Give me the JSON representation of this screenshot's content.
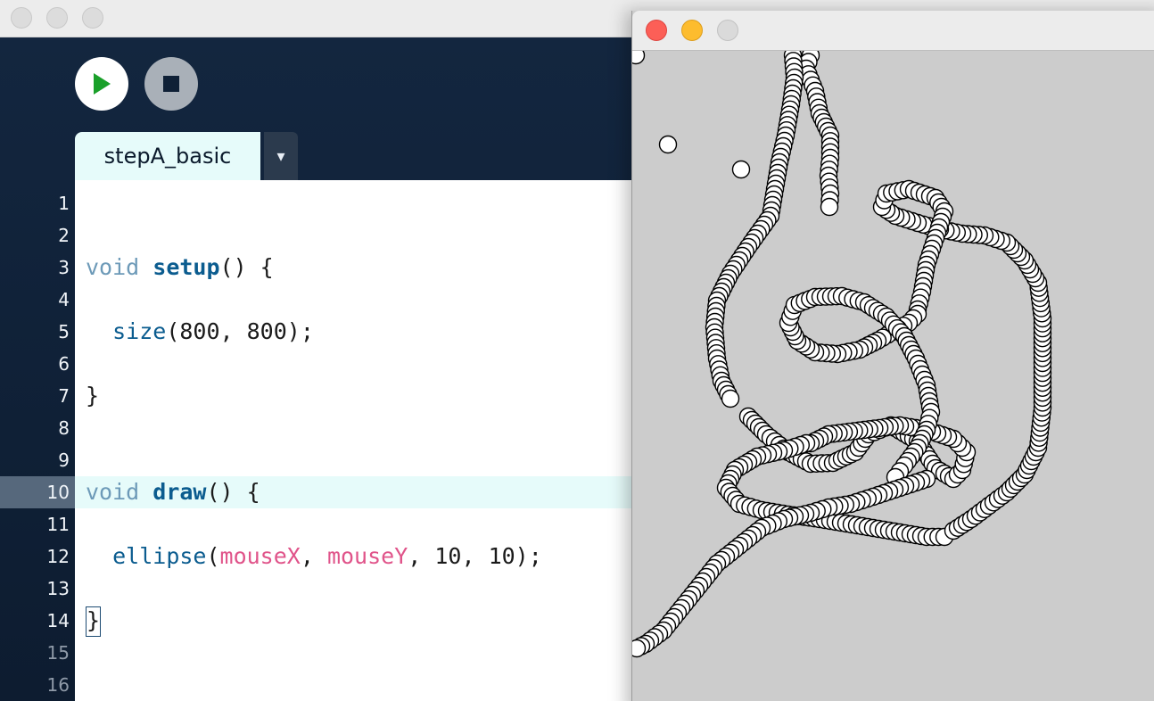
{
  "editor": {
    "tab_label": "stepA_basic",
    "tab_menu_icon": "▾",
    "active_line": 10,
    "lines": [
      {
        "num": "1",
        "segments": []
      },
      {
        "num": "2",
        "segments": []
      },
      {
        "num": "3",
        "segments": [
          {
            "t": "void ",
            "c": "kw"
          },
          {
            "t": "setup",
            "c": "fn-bold"
          },
          {
            "t": "() {",
            "c": ""
          }
        ]
      },
      {
        "num": "4",
        "segments": []
      },
      {
        "num": "5",
        "segments": [
          {
            "t": "  ",
            "c": ""
          },
          {
            "t": "size",
            "c": "fn"
          },
          {
            "t": "(800, 800);",
            "c": ""
          }
        ]
      },
      {
        "num": "6",
        "segments": []
      },
      {
        "num": "7",
        "segments": [
          {
            "t": "}",
            "c": ""
          }
        ]
      },
      {
        "num": "8",
        "segments": []
      },
      {
        "num": "9",
        "segments": []
      },
      {
        "num": "10",
        "segments": [
          {
            "t": "void ",
            "c": "kw"
          },
          {
            "t": "draw",
            "c": "fn-bold"
          },
          {
            "t": "() {",
            "c": ""
          }
        ]
      },
      {
        "num": "11",
        "segments": []
      },
      {
        "num": "12",
        "segments": [
          {
            "t": "  ",
            "c": ""
          },
          {
            "t": "ellipse",
            "c": "fn"
          },
          {
            "t": "(",
            "c": ""
          },
          {
            "t": "mouseX",
            "c": "var"
          },
          {
            "t": ", ",
            "c": ""
          },
          {
            "t": "mouseY",
            "c": "var"
          },
          {
            "t": ", 10, 10);",
            "c": ""
          }
        ]
      },
      {
        "num": "13",
        "segments": []
      },
      {
        "num": "14",
        "segments": [
          {
            "t": "}",
            "c": "cursor"
          }
        ]
      },
      {
        "num": "15",
        "segments": []
      },
      {
        "num": "16",
        "segments": []
      }
    ]
  },
  "toolbar": {
    "run_icon": "play-icon",
    "stop_icon": "stop-icon"
  },
  "sketch": {
    "background_color": "#cccccc",
    "ellipse_fill": "#ffffff",
    "ellipse_stroke": "#000000"
  },
  "colors": {
    "keyword": "#6d9ab8",
    "function": "#0b5c8f",
    "variable": "#e0548a",
    "run_arrow": "#1aa02a"
  }
}
